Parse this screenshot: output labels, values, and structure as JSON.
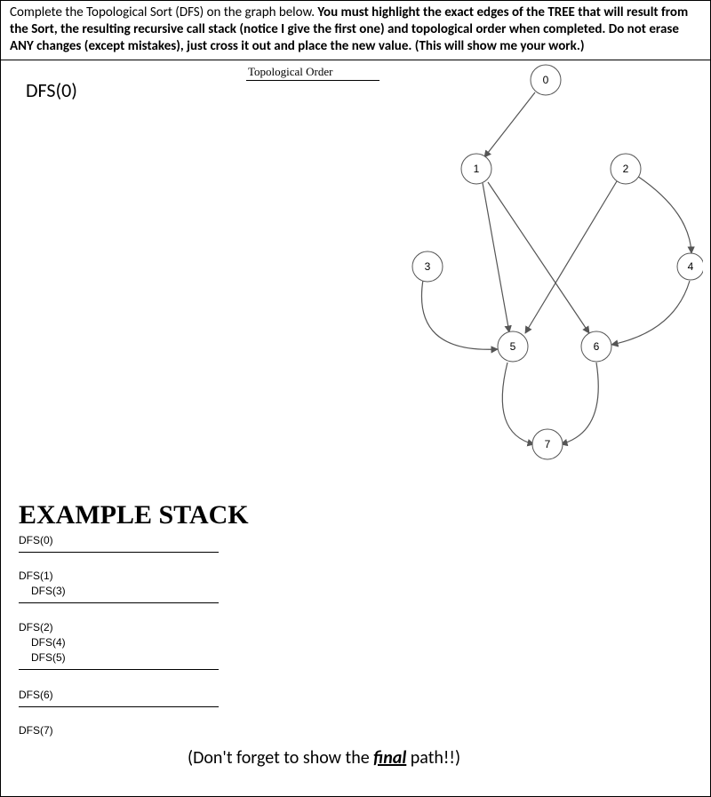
{
  "instructions": {
    "lead": "Complete the Topological Sort (DFS) on the graph below. ",
    "bold": "You must highlight the exact edges of the TREE that will result from the Sort, the resulting recursive call stack (notice I give the first one) and topological order when completed. Do not erase ANY changes (except mistakes), just cross it out and place the new value. (This will show me your work.)"
  },
  "dfs_start": "DFS(0)",
  "topo_label": "Topological Order",
  "graph": {
    "nodes": {
      "n0": "0",
      "n1": "1",
      "n2": "2",
      "n3": "3",
      "n4": "4",
      "n5": "5",
      "n6": "6",
      "n7": "7"
    }
  },
  "example_stack_title": "EXAMPLE STACK",
  "stack": {
    "b0": {
      "r0": "DFS(0)"
    },
    "b1": {
      "r0": "DFS(1)",
      "r1": "DFS(3)"
    },
    "b2": {
      "r0": "DFS(2)",
      "r1": "DFS(4)",
      "r2": "DFS(5)"
    },
    "b3": {
      "r0": "DFS(6)"
    },
    "b4": {
      "r0": "DFS(7)"
    }
  },
  "final_note": {
    "pre": "(Don't forget to show the ",
    "uword": "final",
    "post": " path!!)"
  }
}
